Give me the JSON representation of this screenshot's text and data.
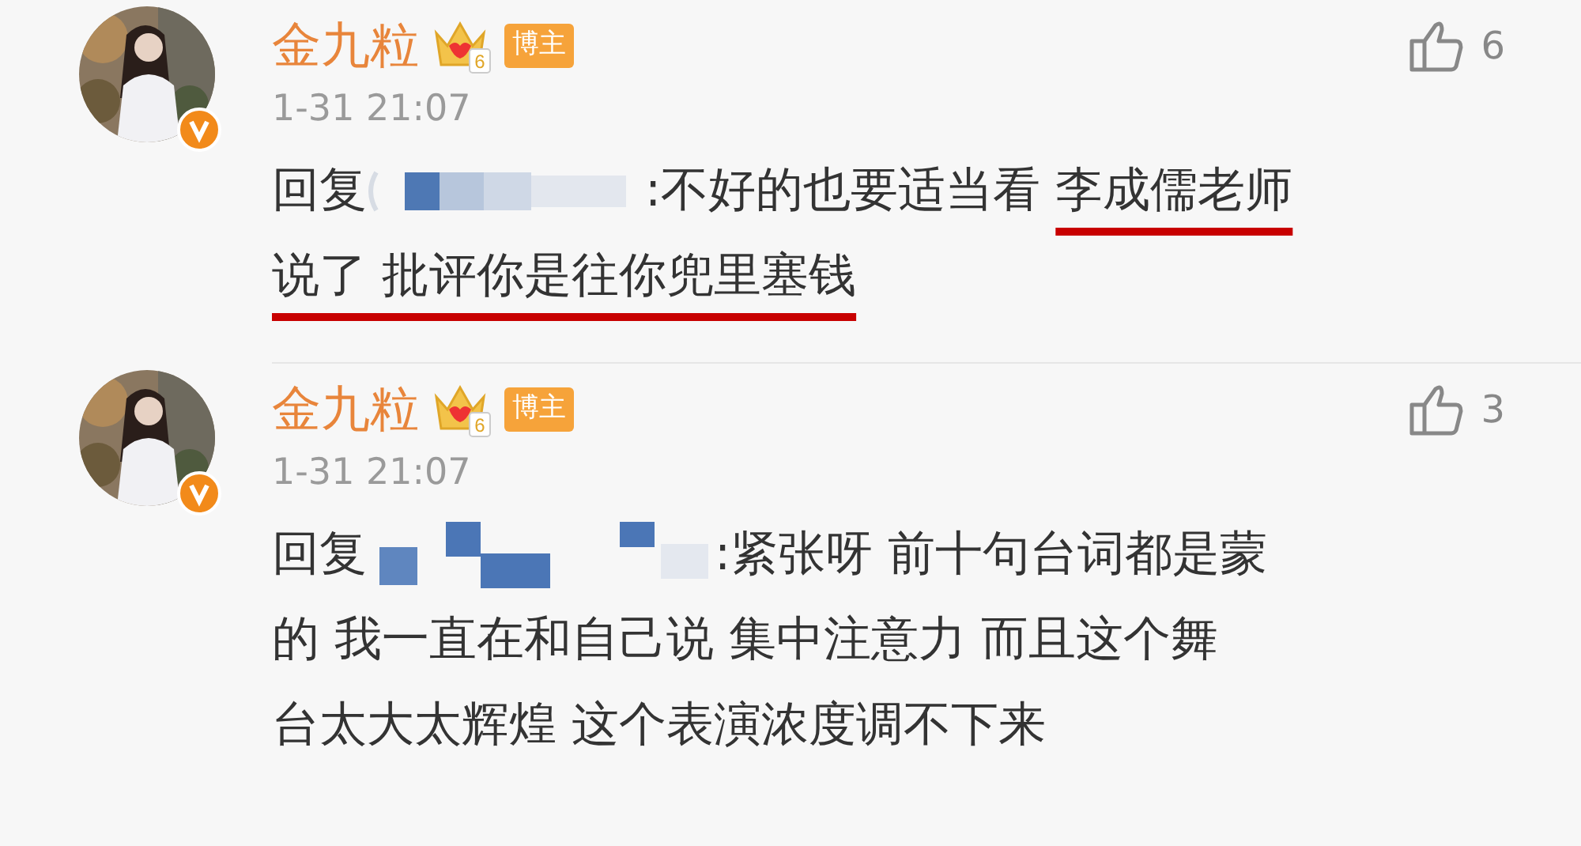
{
  "comments": [
    {
      "author": "金九粒",
      "level": "6",
      "badge": "博主",
      "verified": true,
      "time": "1-31 21:07",
      "likes": "6",
      "reply_prefix": "回复",
      "mention_blurred": true,
      "lines": [
        [
          {
            "text": ":不好的也要适当看 ",
            "underlined": false
          },
          {
            "text": "李成儒老师",
            "underlined": true
          }
        ],
        [
          {
            "text": "说了 批评你是往你兜里塞钱",
            "underlined": true
          }
        ]
      ]
    },
    {
      "author": "金九粒",
      "level": "6",
      "badge": "博主",
      "verified": true,
      "time": "1-31 21:07",
      "likes": "3",
      "reply_prefix": "回复",
      "mention_blurred": true,
      "lines": [
        [
          {
            "text": ":紧张呀 前十句台词都是蒙",
            "underlined": false
          }
        ],
        [
          {
            "text": "的 我一直在和自己说 集中注意力 而且这个舞",
            "underlined": false
          }
        ],
        [
          {
            "text": "台太大太辉煌 这个表演浓度调不下来",
            "underlined": false
          }
        ]
      ]
    }
  ]
}
